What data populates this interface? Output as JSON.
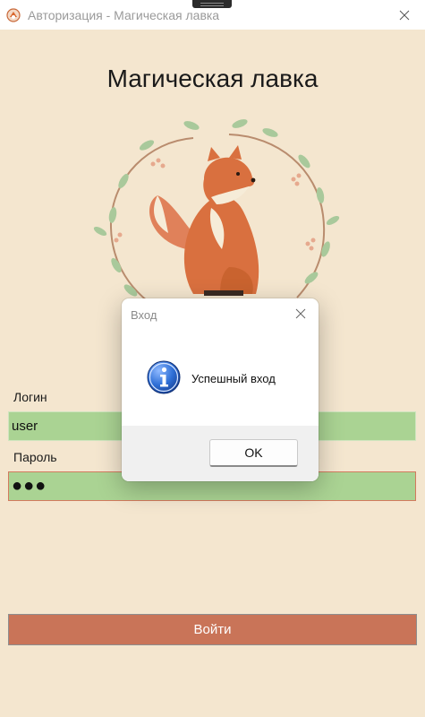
{
  "window": {
    "title": "Авторизация - Магическая лавка",
    "icon": "shop-logo-icon",
    "close_icon": "close-icon"
  },
  "page": {
    "heading": "Магическая лавка",
    "illustration": "fox-wreath-illustration"
  },
  "form": {
    "login_label": "Логин",
    "login_value": "user",
    "password_label": "Пароль",
    "password_value": "●●●",
    "submit_label": "Войти"
  },
  "dialog": {
    "title": "Вход",
    "message": "Успешный вход",
    "ok_label": "OK",
    "icon": "info-icon"
  },
  "colors": {
    "background": "#f4e6cf",
    "input_fill": "#aad393",
    "button_fill": "#c97458",
    "password_border": "#d27a5e"
  }
}
